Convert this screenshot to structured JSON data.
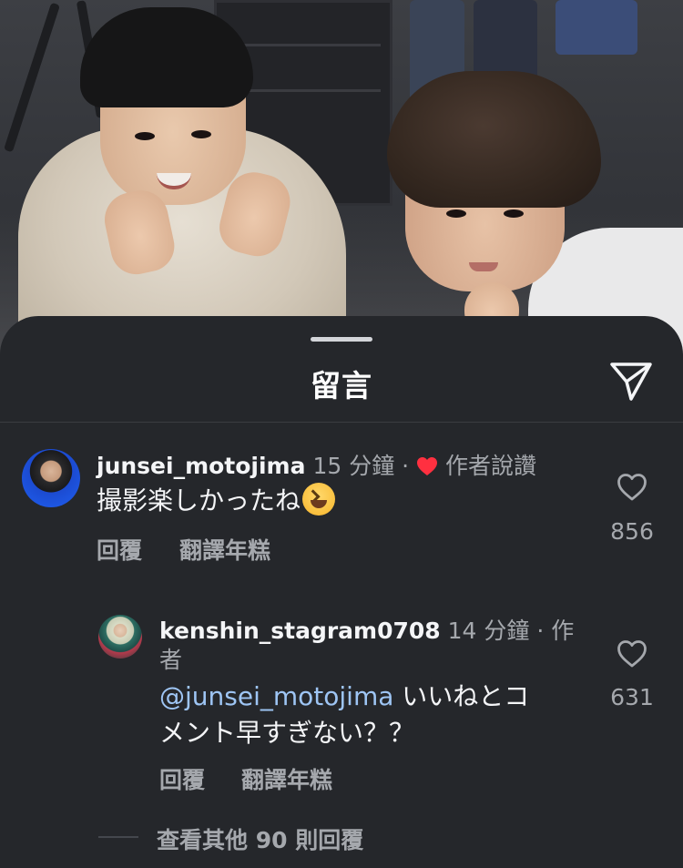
{
  "sheet": {
    "title": "留言"
  },
  "comments": [
    {
      "username": "junsei_motojima",
      "time": "15 分鐘",
      "separator": "·",
      "author_liked": "作者說讚",
      "text": "撮影楽しかったね",
      "emoji": "laughing-face",
      "reply_label": "回覆",
      "translate_label": "翻譯年糕",
      "like_count": "856"
    },
    {
      "username": "kenshin_stagram0708",
      "time": "14 分鐘",
      "separator": "·",
      "author_tag_line1": "作",
      "author_tag_line2": "者",
      "mention": "@junsei_motojima",
      "text_line1_rest": " いいねとコ",
      "text_line2": "メント早すぎない？？",
      "reply_label": "回覆",
      "translate_label": "翻譯年糕",
      "like_count": "631"
    }
  ],
  "view_more": "查看其他 90 則回覆",
  "colors": {
    "background": "#25272b",
    "mention": "#9ec5f4",
    "heart": "#ff3040",
    "secondary_text": "#a5a8ad"
  },
  "icons": [
    "share-send-icon",
    "heart-icon",
    "red-heart-icon",
    "laughing-emoji-icon"
  ]
}
